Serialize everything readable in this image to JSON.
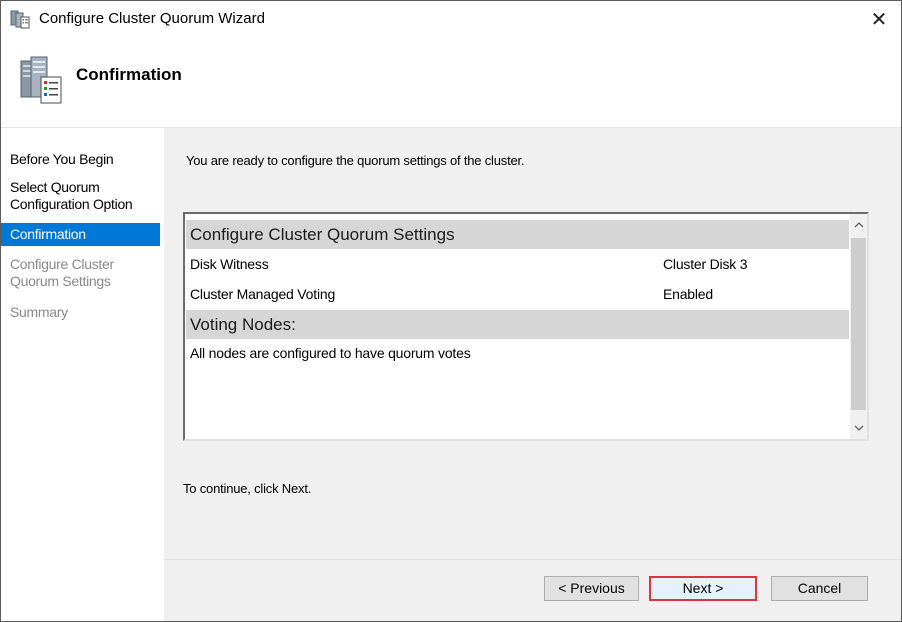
{
  "window": {
    "title": "Configure Cluster Quorum Wizard",
    "close_glyph": "✕"
  },
  "header": {
    "title": "Confirmation"
  },
  "nav": {
    "items": [
      {
        "label": "Before You Begin",
        "state": "enabled"
      },
      {
        "label": "Select Quorum Configuration Option",
        "state": "enabled"
      },
      {
        "label": "Confirmation",
        "state": "active"
      },
      {
        "label": "Configure Cluster Quorum Settings",
        "state": "disabled"
      },
      {
        "label": "Summary",
        "state": "disabled"
      }
    ]
  },
  "content": {
    "intro": "You are ready to configure the quorum settings of the cluster.",
    "listbox": {
      "section1": "Configure Cluster Quorum Settings",
      "rows": [
        {
          "key": "Disk Witness",
          "value": "Cluster Disk 3"
        },
        {
          "key": "Cluster Managed Voting",
          "value": "Enabled"
        }
      ],
      "section2": "Voting Nodes:",
      "note": "All nodes are configured to have quorum votes"
    },
    "continue_text": "To continue, click Next."
  },
  "buttons": {
    "previous": "< Previous",
    "next": "Next >",
    "cancel": "Cancel"
  },
  "colors": {
    "active_nav": "#0078d7",
    "next_highlight": "#d9363e",
    "content_bg": "#f0f0f0"
  }
}
